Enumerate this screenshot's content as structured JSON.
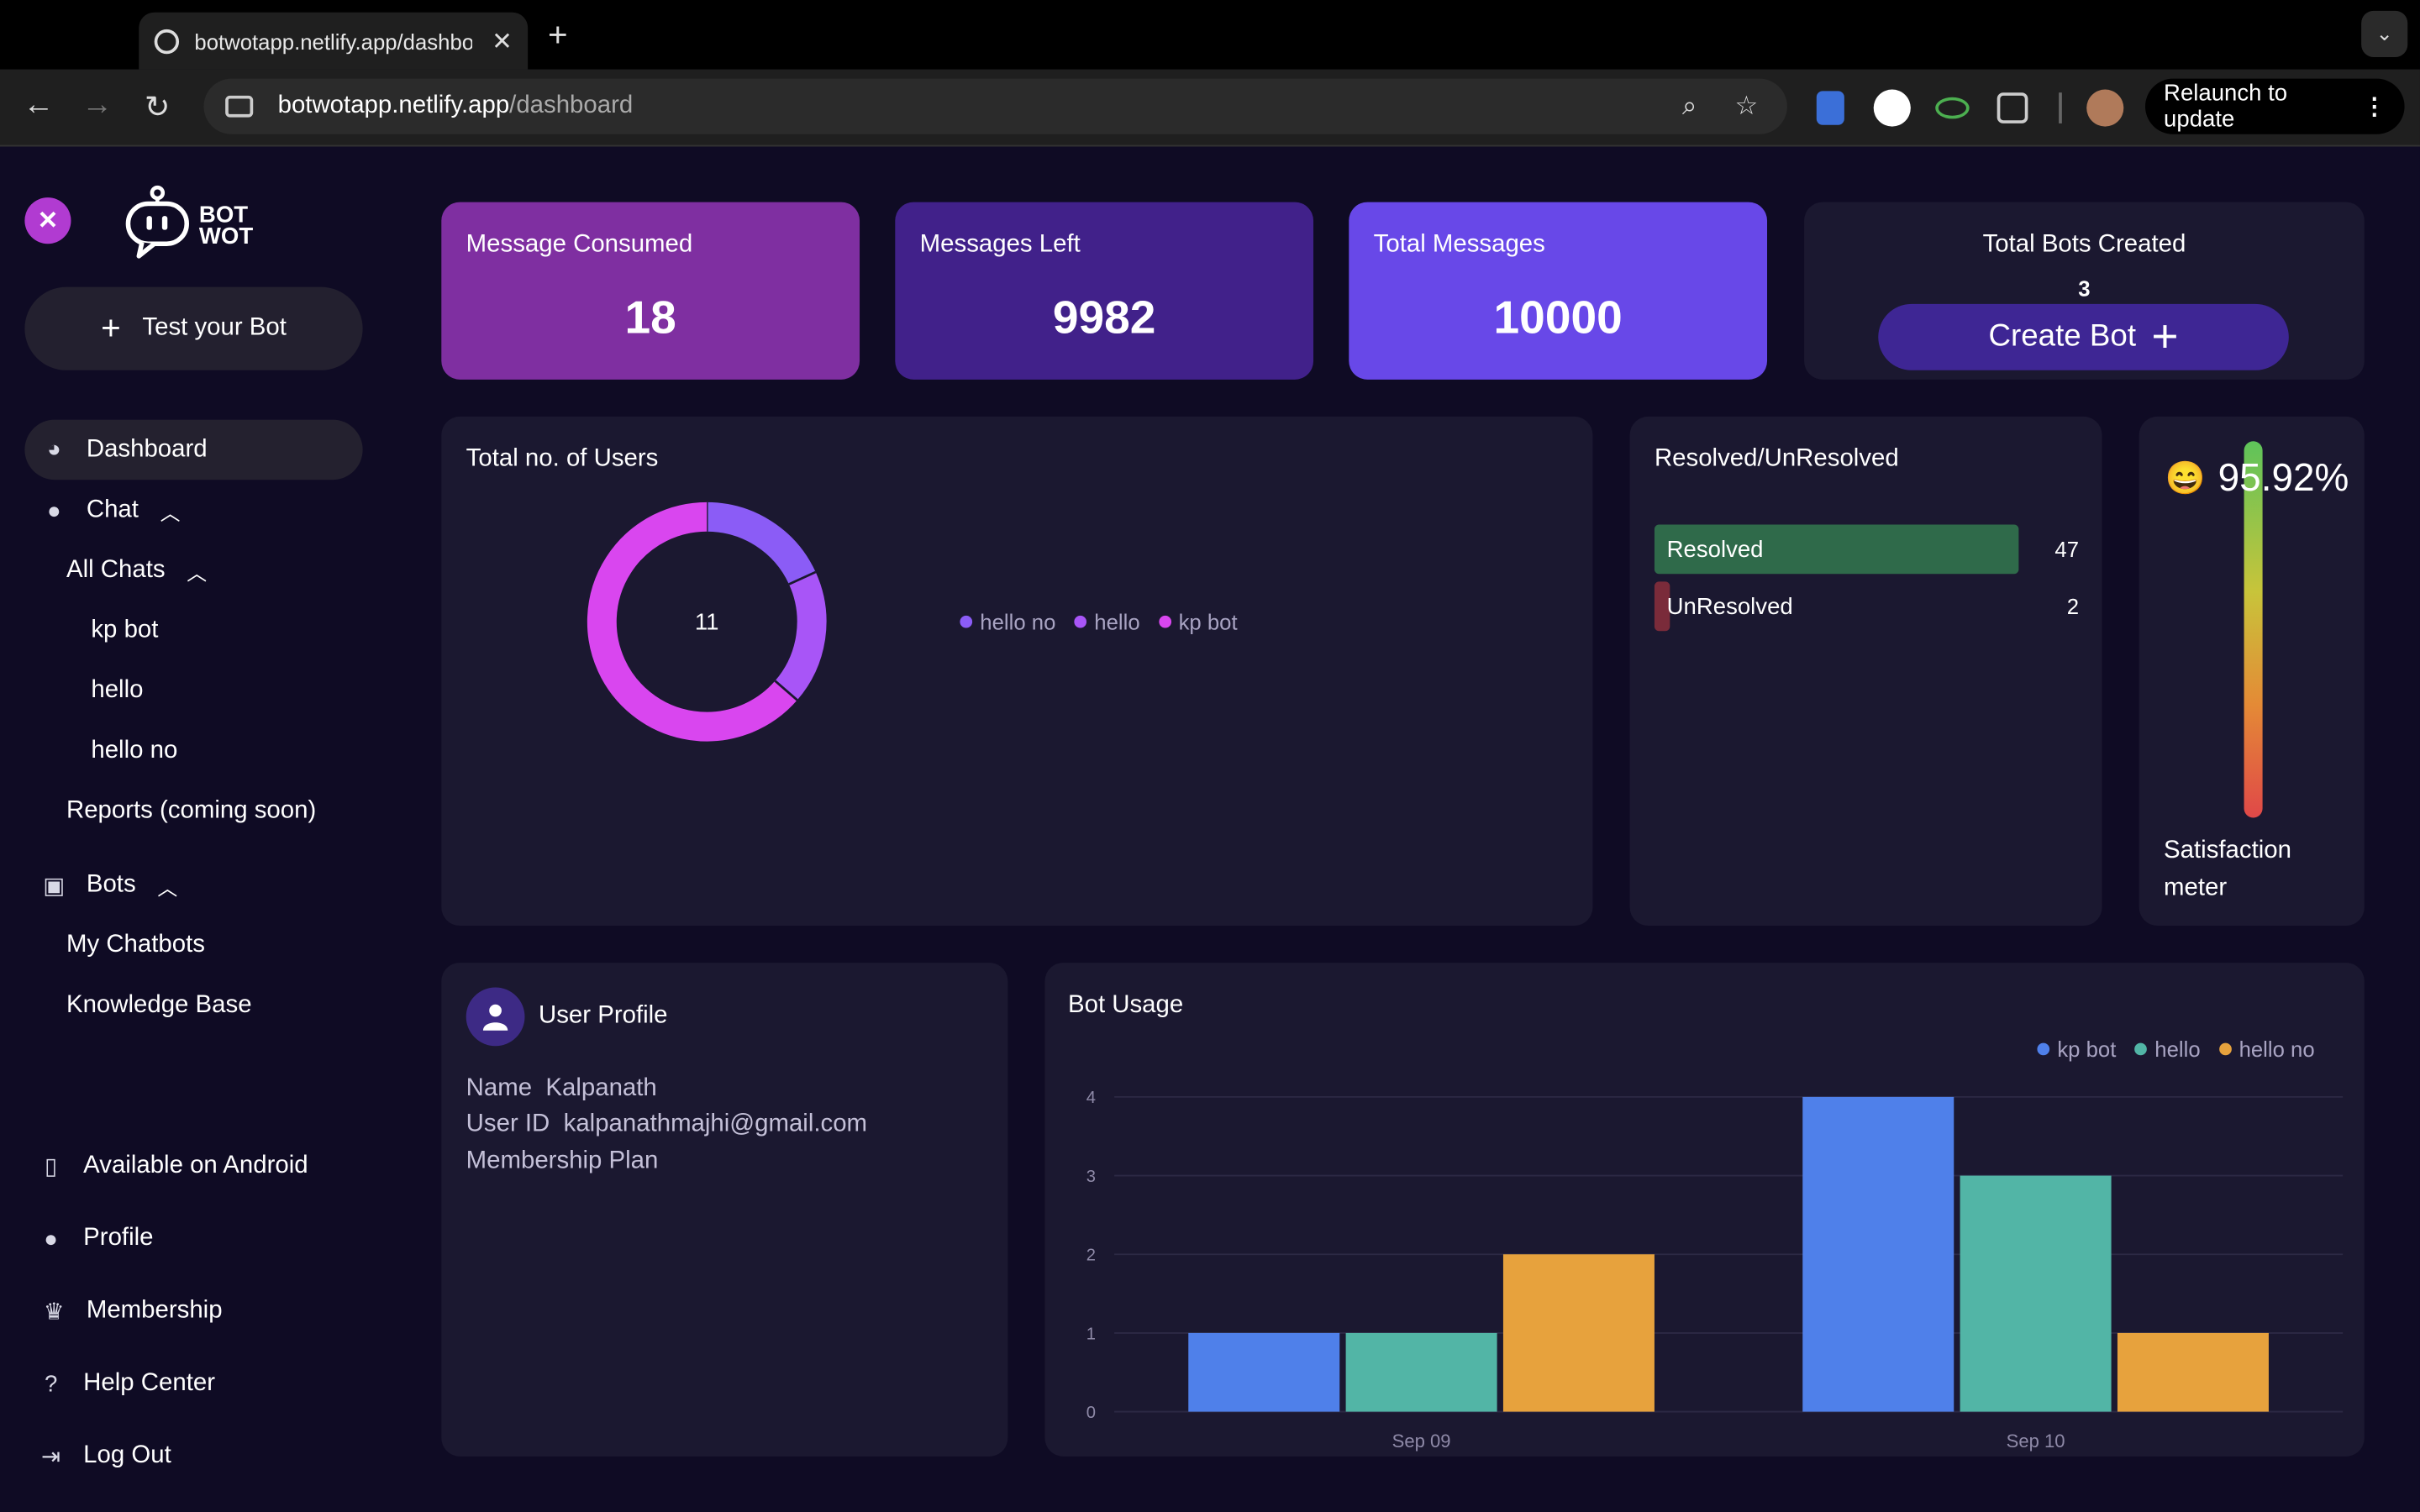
{
  "browser": {
    "tab_title": "botwotapp.netlify.app/dashboard",
    "url_host": "botwotapp.netlify.app",
    "url_path": "/dashboard",
    "relaunch_label": "Relaunch to update"
  },
  "sidebar": {
    "test_bot_label": "Test your Bot",
    "items": {
      "dashboard": "Dashboard",
      "chat": "Chat",
      "all_chats": "All Chats",
      "chat_kp_bot": "kp bot",
      "chat_hello": "hello",
      "chat_hello_no": "hello no",
      "reports": "Reports (coming soon)",
      "bots": "Bots",
      "my_chatbots": "My Chatbots",
      "knowledge_base": "Knowledge Base",
      "android": "Available on Android",
      "profile": "Profile",
      "membership": "Membership",
      "help": "Help Center",
      "logout": "Log Out"
    }
  },
  "stats": {
    "consumed_label": "Message Consumed",
    "consumed_value": "18",
    "left_label": "Messages Left",
    "left_value": "9982",
    "total_label": "Total Messages",
    "total_value": "10000",
    "bots_label": "Total Bots Created",
    "bots_value": "3",
    "create_bot_label": "Create Bot"
  },
  "users_panel": {
    "title": "Total no. of Users",
    "center_value": "11",
    "legend": [
      {
        "name": "hello no",
        "color": "#8b5cf6"
      },
      {
        "name": "hello",
        "color": "#a855f7"
      },
      {
        "name": "kp bot",
        "color": "#d946ef"
      }
    ]
  },
  "resolved_panel": {
    "title": "Resolved/UnResolved",
    "resolved_label": "Resolved",
    "resolved_value": "47",
    "unresolved_label": "UnResolved",
    "unresolved_value": "2"
  },
  "satisfaction": {
    "emoji": "😄",
    "value": "95.92%",
    "label_line1": "Satisfaction",
    "label_line2": "meter"
  },
  "profile": {
    "title": "User Profile",
    "name_label": "Name",
    "name_value": "Kalpanath",
    "id_label": "User ID",
    "id_value": "kalpanathmajhi@gmail.com",
    "plan_label": "Membership Plan"
  },
  "bot_usage_title": "Bot Usage",
  "chart_data": [
    {
      "type": "pie",
      "title": "Total no. of Users",
      "labels": [
        "hello no",
        "hello",
        "kp bot"
      ],
      "values": [
        2,
        2,
        7
      ],
      "colors": [
        "#8b5cf6",
        "#a855f7",
        "#d946ef"
      ]
    },
    {
      "type": "bar",
      "title": "Bot Usage",
      "categories": [
        "Sep 09",
        "Sep 10"
      ],
      "series": [
        {
          "name": "kp bot",
          "values": [
            1,
            4
          ],
          "color": "#4f80ea"
        },
        {
          "name": "hello",
          "values": [
            1,
            3
          ],
          "color": "#52b5a6"
        },
        {
          "name": "hello no",
          "values": [
            2,
            1
          ],
          "color": "#e7a23d"
        }
      ],
      "ylim": [
        0,
        4
      ],
      "yticks": [
        "0",
        "1",
        "2",
        "3",
        "4"
      ],
      "legend": "top-right",
      "grid": true
    }
  ]
}
